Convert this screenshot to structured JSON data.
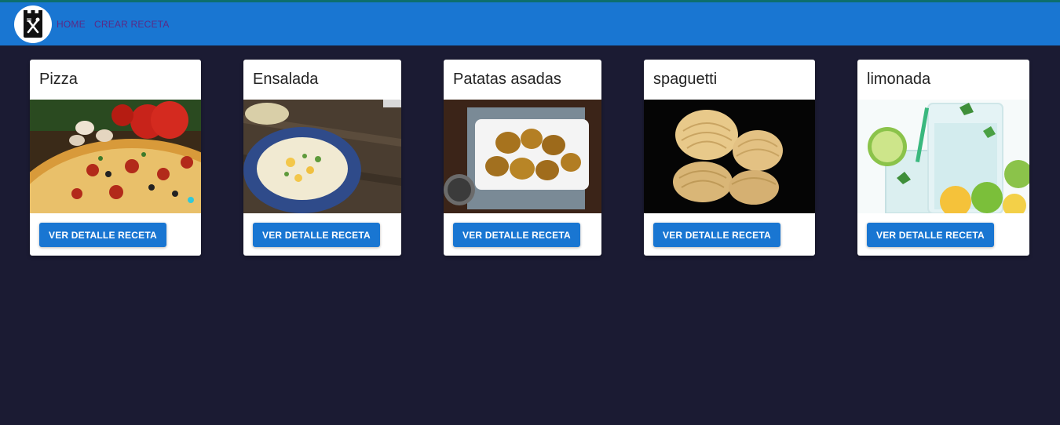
{
  "navbar": {
    "logo_icon": "restaurant-fork-knife-icon",
    "links": [
      "HOME",
      "CREAR RECETA"
    ]
  },
  "colors": {
    "background": "#1b1b33",
    "navbar": "#1976d2",
    "button": "#1976d2",
    "nav_link": "#5b2a86"
  },
  "recipes": [
    {
      "title": "Pizza",
      "image": "pizza-photo",
      "button": "VER DETALLE RECETA"
    },
    {
      "title": "Ensalada",
      "image": "salad-bowl-photo",
      "button": "VER DETALLE RECETA"
    },
    {
      "title": "Patatas asadas",
      "image": "roasted-potatoes-photo",
      "button": "VER DETALLE RECETA"
    },
    {
      "title": "spaguetti",
      "image": "pasta-nests-photo",
      "button": "VER DETALLE RECETA"
    },
    {
      "title": "limonada",
      "image": "lemonade-glasses-photo",
      "button": "VER DETALLE RECETA"
    }
  ]
}
